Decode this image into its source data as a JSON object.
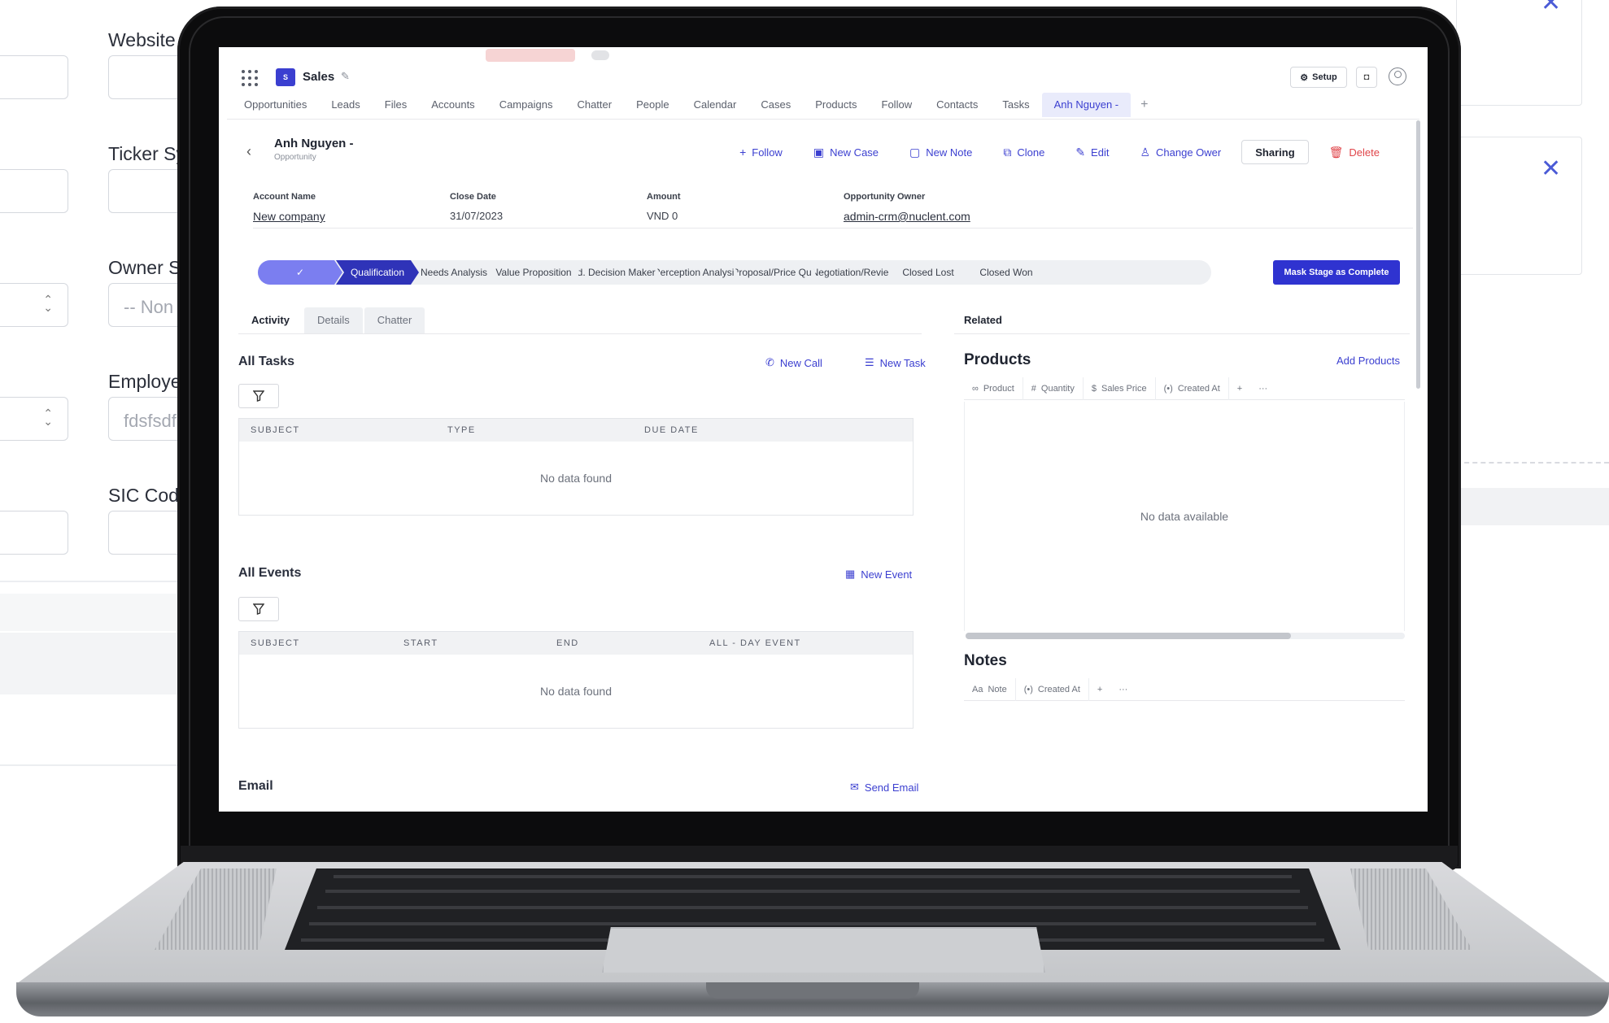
{
  "background_form": {
    "labels": [
      "Website",
      "Ticker Sy",
      "Owner S",
      "Employe",
      "SIC Code"
    ],
    "owner_placeholder": "-- Non",
    "employee_value": "fdsfsdf"
  },
  "app": {
    "badge": "S",
    "title": "Sales",
    "setup_label": "Setup",
    "nav_tabs": [
      "Opportunities",
      "Leads",
      "Files",
      "Accounts",
      "Campaigns",
      "Chatter",
      "People",
      "Calendar",
      "Cases",
      "Products",
      "Follow",
      "Contacts",
      "Tasks",
      "Anh Nguyen -"
    ],
    "active_tab_index": 13
  },
  "record": {
    "title": "Anh Nguyen -",
    "subtitle": "Opportunity",
    "actions": {
      "follow": "Follow",
      "new_case": "New Case",
      "new_note": "New Note",
      "clone": "Clone",
      "edit": "Edit",
      "change_owner": "Change Ower",
      "sharing": "Sharing",
      "delete": "Delete"
    },
    "fields": [
      {
        "label": "Account Name",
        "value": "New company"
      },
      {
        "label": "Close Date",
        "value": "31/07/2023"
      },
      {
        "label": "Amount",
        "value": "VND 0"
      },
      {
        "label": "Opportunity Owner",
        "value": "admin-crm@nuclent.com"
      }
    ]
  },
  "path": {
    "stages": [
      "",
      "Qualification",
      "Needs Analysis",
      "Value Proposition",
      "Id. Decision Maker",
      "Perception Analysi",
      "Proposal/Price Qu",
      "Negotiation/Revie",
      "Closed Lost",
      "Closed Won"
    ],
    "done_index": 0,
    "current_index": 1,
    "mark_button": "Mask Stage as Complete"
  },
  "activity": {
    "tabs": [
      "Activity",
      "Details",
      "Chatter"
    ],
    "tasks": {
      "title": "All Tasks",
      "new_call": "New Call",
      "new_task": "New Task",
      "columns": [
        "SUBJECT",
        "TYPE",
        "DUE DATE"
      ],
      "empty": "No data found"
    },
    "events": {
      "title": "All Events",
      "new_event": "New Event",
      "columns": [
        "SUBJECT",
        "START",
        "END",
        "ALL - DAY EVENT"
      ],
      "empty": "No data found"
    },
    "email": {
      "title": "Email",
      "send_email": "Send Email"
    }
  },
  "related": {
    "tab": "Related",
    "products": {
      "title": "Products",
      "add_label": "Add Products",
      "columns": [
        "Product",
        "Quantity",
        "Sales Price",
        "Created At"
      ],
      "empty": "No data available"
    },
    "notes": {
      "title": "Notes",
      "columns": [
        "Note",
        "Created At"
      ]
    }
  },
  "colors": {
    "accent": "#3b3fd0",
    "path_current": "#2f33b8",
    "path_done": "#7b7ef0",
    "delete": "#e0454a"
  }
}
